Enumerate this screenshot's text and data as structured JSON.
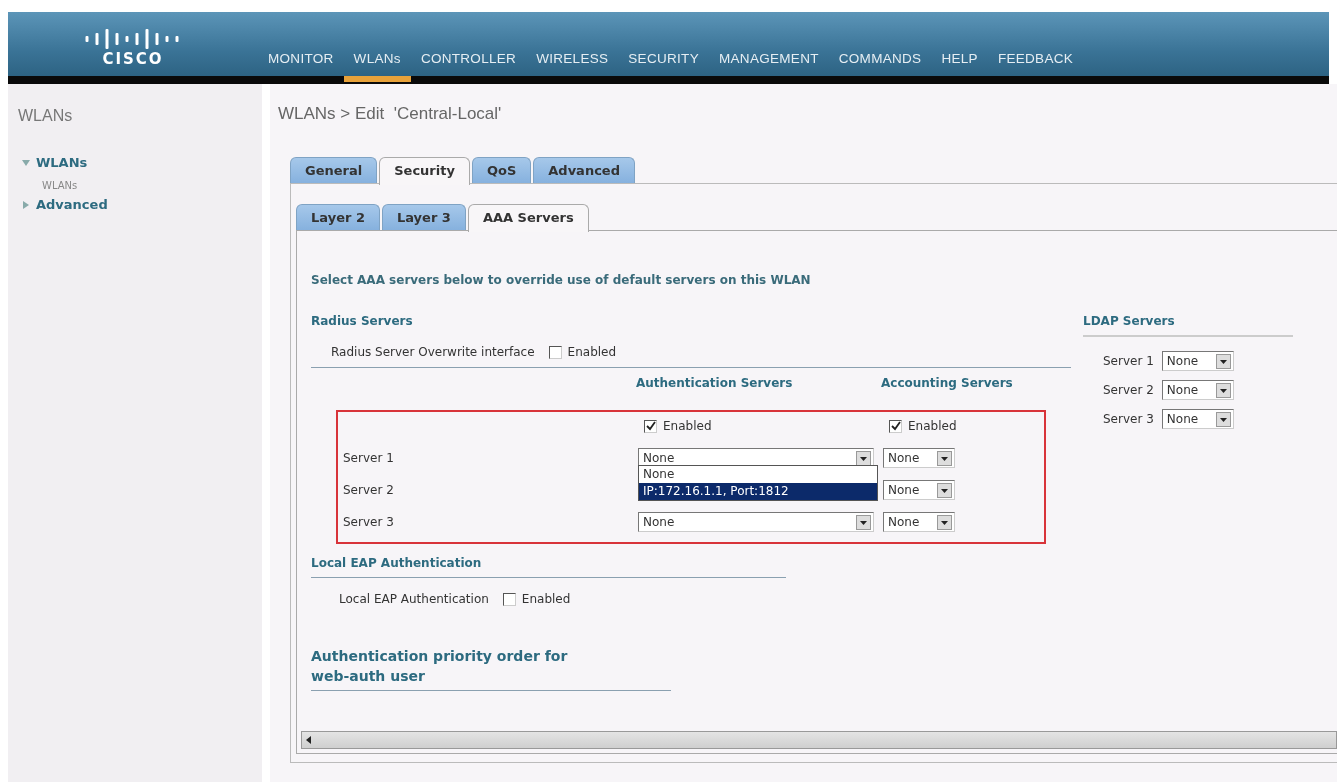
{
  "header": {
    "logo": "CISCO",
    "nav": [
      {
        "label": "MONITOR",
        "selected": false
      },
      {
        "label": "WLANs",
        "selected": true
      },
      {
        "label": "CONTROLLER",
        "selected": false
      },
      {
        "label": "WIRELESS",
        "selected": false
      },
      {
        "label": "SECURITY",
        "selected": false
      },
      {
        "label": "MANAGEMENT",
        "selected": false
      },
      {
        "label": "COMMANDS",
        "selected": false
      },
      {
        "label": "HELP",
        "selected": false
      },
      {
        "label": "FEEDBACK",
        "selected": false
      }
    ]
  },
  "sidebar": {
    "title": "WLANs",
    "items": [
      {
        "label": "WLANs",
        "expanded": true,
        "children": [
          {
            "label": "WLANs"
          }
        ]
      },
      {
        "label": "Advanced",
        "expanded": false
      }
    ]
  },
  "page_title": "WLANs > Edit  'Central-Local'",
  "tabs": [
    {
      "label": "General",
      "selected": false
    },
    {
      "label": "Security",
      "selected": true
    },
    {
      "label": "QoS",
      "selected": false
    },
    {
      "label": "Advanced",
      "selected": false
    }
  ],
  "subtabs": [
    {
      "label": "Layer 2",
      "selected": false
    },
    {
      "label": "Layer 3",
      "selected": false
    },
    {
      "label": "AAA Servers",
      "selected": true
    }
  ],
  "intro": "Select AAA servers below to override use of default servers on this WLAN",
  "radius": {
    "title": "Radius Servers",
    "overwrite": {
      "label": "Radius Server Overwrite interface",
      "option": "Enabled",
      "checked": false
    },
    "auth_header": "Authentication Servers",
    "acct_header": "Accounting Servers",
    "auth_enabled": {
      "label": "Enabled",
      "checked": true
    },
    "acct_enabled": {
      "label": "Enabled",
      "checked": true
    },
    "servers": [
      {
        "label": "Server 1",
        "auth": "None",
        "acct": "None"
      },
      {
        "label": "Server 2",
        "acct": "None"
      },
      {
        "label": "Server 3",
        "auth": "None",
        "acct": "None"
      }
    ],
    "open_list": [
      {
        "label": "None",
        "selected": false
      },
      {
        "label": "IP:172.16.1.1, Port:1812",
        "selected": true
      }
    ]
  },
  "ldap": {
    "title": "LDAP Servers",
    "servers": [
      {
        "label": "Server 1",
        "value": "None"
      },
      {
        "label": "Server 2",
        "value": "None"
      },
      {
        "label": "Server 3",
        "value": "None"
      }
    ]
  },
  "local_eap": {
    "title": "Local EAP Authentication",
    "label": "Local EAP Authentication",
    "option": "Enabled",
    "checked": false
  },
  "priority": {
    "title": "Authentication priority order for web-auth user"
  }
}
